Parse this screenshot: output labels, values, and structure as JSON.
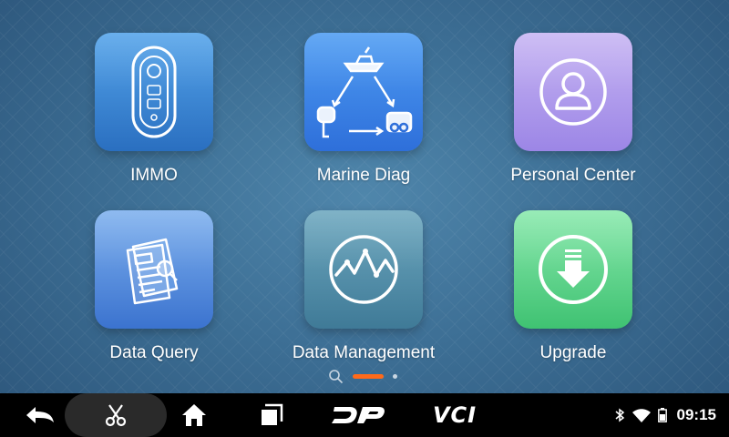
{
  "apps": [
    {
      "id": "immo",
      "label": "IMMO"
    },
    {
      "id": "marine",
      "label": "Marine Diag"
    },
    {
      "id": "personal",
      "label": "Personal Center"
    },
    {
      "id": "query",
      "label": "Data Query"
    },
    {
      "id": "mgmt",
      "label": "Data Management"
    },
    {
      "id": "upgrade",
      "label": "Upgrade"
    }
  ],
  "pager": {
    "pages": 2,
    "current": 1,
    "icon": "search-icon",
    "active_color": "#ff6a1a"
  },
  "navbar": {
    "dp_label": "DP",
    "vci_label": "VCI",
    "icons": [
      "back-arrow-icon",
      "scissors-icon",
      "home-icon",
      "recent-apps-icon"
    ]
  },
  "status": {
    "time": "09:15",
    "icons": [
      "bluetooth-icon",
      "wifi-icon",
      "battery-icon"
    ]
  }
}
